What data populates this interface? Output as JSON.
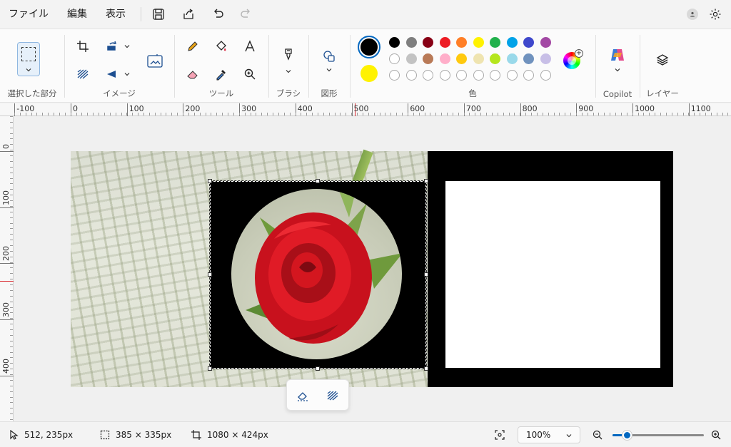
{
  "menu": {
    "file": "ファイル",
    "edit": "編集",
    "view": "表示"
  },
  "quick_icons": [
    "save-icon",
    "share-icon",
    "undo-icon",
    "redo-icon"
  ],
  "ribbon": {
    "groups": {
      "selection": "選択した部分",
      "image": "イメージ",
      "tools": "ツール",
      "brushes": "ブラシ",
      "shapes": "図形",
      "colors": "色",
      "copilot": "Copilot",
      "layers": "レイヤー"
    },
    "colors": {
      "primary": "#000000",
      "secondary": "#fff200",
      "palette_row1": [
        "#000000",
        "#7f7f7f",
        "#880015",
        "#ed1c24",
        "#ff7f27",
        "#fff200",
        "#22b14c",
        "#00a2e8",
        "#3f48cc",
        "#a349a4"
      ],
      "palette_row2": [
        "#ffffff",
        "#c3c3c3",
        "#b97a57",
        "#ffaec9",
        "#ffc90e",
        "#efe4b0",
        "#b5e61d",
        "#99d9ea",
        "#7092be",
        "#c8bfe7"
      ]
    }
  },
  "rulers": {
    "horizontal": [
      "-100",
      "0",
      "100",
      "200",
      "300",
      "400",
      "500",
      "600",
      "700",
      "800",
      "900",
      "1000",
      "1100"
    ],
    "vertical": [
      "0",
      "100",
      "200",
      "300",
      "400"
    ]
  },
  "status": {
    "cursor_position": "512, 235px",
    "selection_size": "385 × 335px",
    "canvas_size": "1080 × 424px",
    "zoom": "100%"
  }
}
